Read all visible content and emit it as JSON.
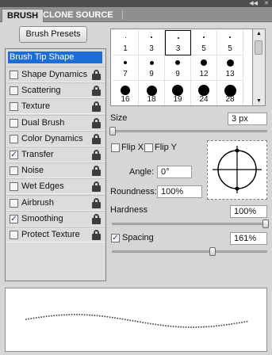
{
  "tabs": {
    "active": "BRUSH",
    "inactive": "CLONE SOURCE"
  },
  "brush_presets_label": "Brush Presets",
  "sidebar": {
    "tip_shape": "Brush Tip Shape",
    "items": [
      {
        "label": "Shape Dynamics",
        "checked": false,
        "lock": true
      },
      {
        "label": "Scattering",
        "checked": false,
        "lock": true
      },
      {
        "label": "Texture",
        "checked": false,
        "lock": true
      },
      {
        "label": "Dual Brush",
        "checked": false,
        "lock": true
      },
      {
        "label": "Color Dynamics",
        "checked": false,
        "lock": true
      },
      {
        "label": "Transfer",
        "checked": true,
        "lock": true
      },
      {
        "label": "Noise",
        "checked": false,
        "lock": true
      },
      {
        "label": "Wet Edges",
        "checked": false,
        "lock": true
      },
      {
        "label": "Airbrush",
        "checked": false,
        "lock": true
      },
      {
        "label": "Smoothing",
        "checked": true,
        "lock": true
      },
      {
        "label": "Protect Texture",
        "checked": false,
        "lock": true
      }
    ]
  },
  "brush_tips": [
    {
      "label": "1",
      "size": 1
    },
    {
      "label": "3",
      "size": 2
    },
    {
      "label": "3",
      "size": 2,
      "selected": true
    },
    {
      "label": "5",
      "size": 2
    },
    {
      "label": "5",
      "size": 2
    },
    {
      "label": "7",
      "size": 4
    },
    {
      "label": "9",
      "size": 5
    },
    {
      "label": "9",
      "size": 6
    },
    {
      "label": "12",
      "size": 8
    },
    {
      "label": "13",
      "size": 9
    },
    {
      "label": "16",
      "size": 12
    },
    {
      "label": "18",
      "size": 13
    },
    {
      "label": "19",
      "size": 14
    },
    {
      "label": "24",
      "size": 14
    },
    {
      "label": "28",
      "size": 15
    }
  ],
  "size": {
    "label": "Size",
    "value": "3 px"
  },
  "flip_x": {
    "label": "Flip X",
    "checked": false
  },
  "flip_y": {
    "label": "Flip Y",
    "checked": false
  },
  "angle": {
    "label": "Angle:",
    "value": "0°"
  },
  "roundness": {
    "label": "Roundness:",
    "value": "100%"
  },
  "hardness": {
    "label": "Hardness",
    "value": "100%"
  },
  "spacing": {
    "label": "Spacing",
    "value": "161%",
    "checked": true
  },
  "colors": {
    "accent": "#1c6dd6",
    "panel": "#d6d6d6"
  }
}
